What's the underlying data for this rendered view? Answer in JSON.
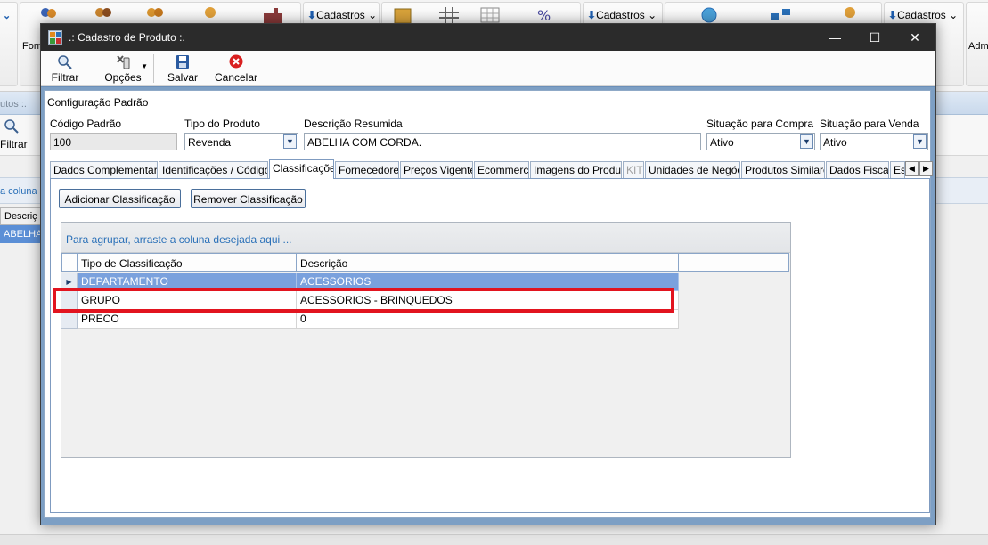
{
  "background": {
    "ribbon": {
      "left_dropdown_arrow": "⌄",
      "dropdowns": [
        "Cadastros",
        "Cadastros",
        "Cadastros"
      ],
      "left_label": "Forn",
      "right_label": "Admi"
    },
    "strip_text": "utos :.",
    "filter_label": "Filtrar",
    "hint_text": "a coluna d",
    "grid_header": "Descriç",
    "grid_row": "ABELHA"
  },
  "window": {
    "title": ".: Cadastro de Produto :.",
    "controls": {
      "minimize": "—",
      "maximize": "☐",
      "close": "✕"
    },
    "toolbar": {
      "filter_label": "Filtrar",
      "options_label": "Opções",
      "save_label": "Salvar",
      "cancel_label": "Cancelar"
    },
    "config": {
      "section_title": "Configuração Padrão",
      "codigo_label": "Código Padrão",
      "codigo_value": "100",
      "tipo_label": "Tipo do Produto",
      "tipo_value": "Revenda",
      "descricao_label": "Descrição Resumida",
      "descricao_value": "ABELHA COM CORDA.",
      "sit_compra_label": "Situação para Compra",
      "sit_compra_value": "Ativo",
      "sit_venda_label": "Situação para Venda",
      "sit_venda_value": "Ativo"
    },
    "tabs": [
      {
        "label": "Dados Complementares",
        "active": false,
        "disabled": false
      },
      {
        "label": "Identificações / Códigos",
        "active": false,
        "disabled": false
      },
      {
        "label": "Classificações",
        "active": true,
        "disabled": false
      },
      {
        "label": "Fornecedores",
        "active": false,
        "disabled": false
      },
      {
        "label": "Preços Vigentes",
        "active": false,
        "disabled": false
      },
      {
        "label": "Ecommerce",
        "active": false,
        "disabled": false
      },
      {
        "label": "Imagens do Produto",
        "active": false,
        "disabled": false
      },
      {
        "label": "KIT",
        "active": false,
        "disabled": true
      },
      {
        "label": "Unidades de Negócio",
        "active": false,
        "disabled": false
      },
      {
        "label": "Produtos Similares",
        "active": false,
        "disabled": false
      },
      {
        "label": "Dados Fiscais",
        "active": false,
        "disabled": false
      },
      {
        "label": "Es",
        "active": false,
        "disabled": false
      }
    ],
    "tab_scroll": {
      "left": "◀",
      "right": "▶"
    },
    "classificacoes": {
      "add_button": "Adicionar Classificação",
      "remove_button": "Remover Classificação",
      "group_hint": "Para agrupar, arraste a coluna desejada aqui ...",
      "columns": [
        "Tipo de Classificação",
        "Descrição"
      ],
      "rows": [
        {
          "tipo": "DEPARTAMENTO",
          "descricao": "ACESSORIOS",
          "selected": true
        },
        {
          "tipo": "GRUPO",
          "descricao": "ACESSORIOS - BRINQUEDOS",
          "selected": false
        },
        {
          "tipo": "PRECO",
          "descricao": "0",
          "selected": false
        }
      ],
      "row_indicator": "▶"
    }
  },
  "colors": {
    "highlight": "#e2141f",
    "selected_row": "#7aa1dd",
    "titlebar": "#2b2b2b",
    "accent": "#2a70b8"
  }
}
